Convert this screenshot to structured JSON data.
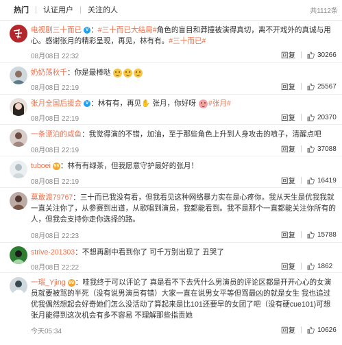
{
  "tabs": [
    "热门",
    "认证用户",
    "关注的人"
  ],
  "total": "共1112条",
  "reply_label": "回复",
  "comments": [
    {
      "user": "电视剧三十而已",
      "sep": "：",
      "hashtag1": "#三十而已大结局#",
      "text": "角色的盲目和莽撞被演得真切，离不开戏外的真诚与用心。感谢张月的精彩呈现，再见，林有有。",
      "hashtag2": "#三十而已#",
      "time": "08月08日 22:32",
      "likes": "30266"
    },
    {
      "user": "奶奶荡秋千",
      "sep": "：",
      "text": "你是最棒哒",
      "time": "08月08日 22:19",
      "likes": "25567"
    },
    {
      "user": "张月全国后援会",
      "sep": "：",
      "text_a": "林有有，再见",
      "text_b": "张月，你好呀",
      "hashtag": "#张月#",
      "time": "08月08日 22:19",
      "likes": "20370"
    },
    {
      "user": "一条漂泊的咸鱼",
      "sep": "：",
      "text": "我觉得演的不错，加油，至于那些角色上升到人身攻击的喷子，清醒点吧",
      "time": "08月08日 22:19",
      "likes": "37088"
    },
    {
      "user": "tuboei",
      "sep": "：",
      "text": "林有有绿茶，但我愿意守护最好的张月！",
      "time": "08月08日 22:19",
      "likes": "16419"
    },
    {
      "user": "莫敢渡79767",
      "sep": "：",
      "text": "三十而已我没有看，但我看见这种网络暴力实在是心疼你。我从天生是优我我就一直关注你了，从参赛到出道，从歌唱到演员，我都能看到。我不是那个一直都能关注你所有的人，但我会支持你走你选择的路。",
      "time": "08月08日 22:23",
      "likes": "15788"
    },
    {
      "user": "strive-201303",
      "sep": "：",
      "text": "不想再剧中看到你了 可千万别出现了 丑哭了",
      "time": "08月08日 22:22",
      "likes": "1862"
    },
    {
      "user": "一瑙_Yjing",
      "sep": "：",
      "text": "哇我终于可以评论了 真是看不下去凭什么男演员的评论区都是开开心心的女演员就要被骂的半死（没有说男演员有错）大家一直在说男女平等但骂最凶的就是女生 我也追过优我偶然想起会好奇她们怎么没活动了算起来是比101还要早的女团了吧（没有硬cue101)可想张月能得到这次机会有多不容易 不理解那些指责她",
      "time": "今天05:34",
      "likes": "10626"
    }
  ]
}
